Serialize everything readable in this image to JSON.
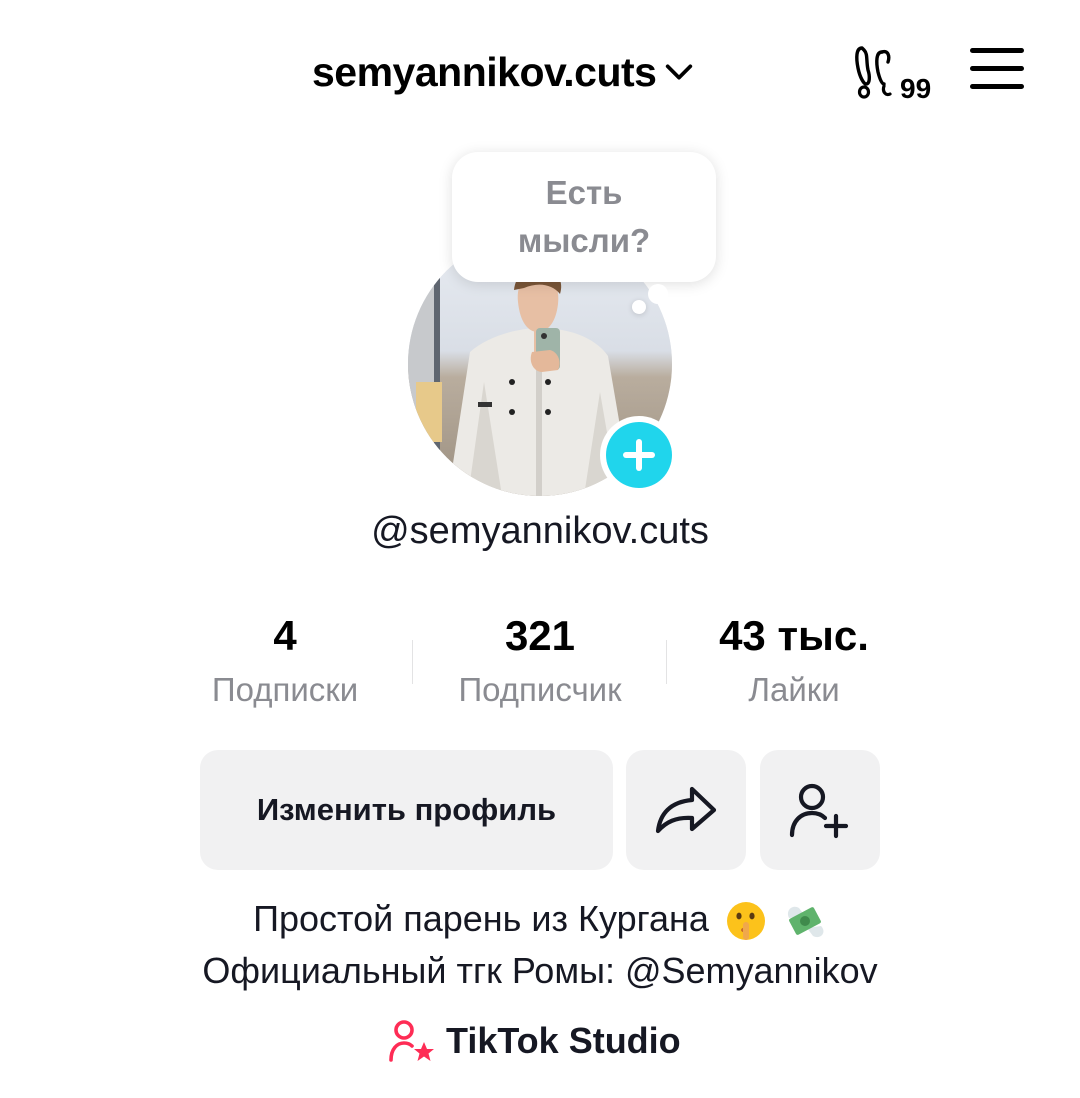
{
  "header": {
    "username": "semyannikov.cuts",
    "inbox_badge": "99",
    "icons": {
      "switch_account": "chevron-down-icon",
      "threads": "footprint-bubble-icon",
      "menu": "hamburger-menu-icon"
    }
  },
  "profile": {
    "thought_prompt": "Есть\nмысли?",
    "handle": "@semyannikov.cuts",
    "accent_color": "#20d5ec"
  },
  "stats": [
    {
      "value": "4",
      "label": "Подписки"
    },
    {
      "value": "321",
      "label": "Подписчик"
    },
    {
      "value": "43 тыс.",
      "label": "Лайки"
    }
  ],
  "actions": {
    "edit_profile": "Изменить профиль",
    "share_icon": "share-arrow-icon",
    "add_friend_icon": "add-user-icon"
  },
  "bio": {
    "line1": "Простой парень из Кургана",
    "line1_emojis": [
      "shushing-face-emoji",
      "money-with-wings-emoji"
    ],
    "line2": "Официальный тгк Ромы: @Semyannikov"
  },
  "studio": {
    "label": "TikTok Studio",
    "icon": "creator-star-icon",
    "accent_color": "#fe2c55"
  }
}
